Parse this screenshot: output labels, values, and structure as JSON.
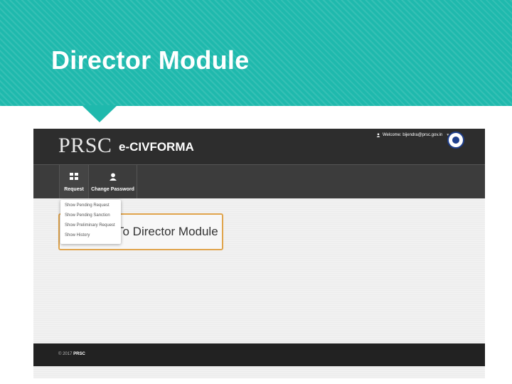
{
  "slide": {
    "title": "Director Module"
  },
  "app": {
    "logo_main": "PRSC",
    "logo_sub": "e-CIVFORMA",
    "welcome_user": "Welcome: bijendra@prsc.gov.in",
    "nav": [
      {
        "label": "Request",
        "icon": "grid-icon"
      },
      {
        "label": "Change Password",
        "icon": "user-icon"
      }
    ],
    "dropdown": [
      "Show Pending Request",
      "Show Pending Sanction",
      "Show Preliminary Request",
      "Show History"
    ],
    "welcome_message": "To Director Module",
    "footer": {
      "copyright": "© 2017",
      "org": "PRSC"
    }
  },
  "colors": {
    "banner": "#1fb9ad",
    "topbar": "#2d2d2d",
    "navbar": "#3c3c3c",
    "panel_border": "#e0a44c",
    "footer": "#222222"
  }
}
